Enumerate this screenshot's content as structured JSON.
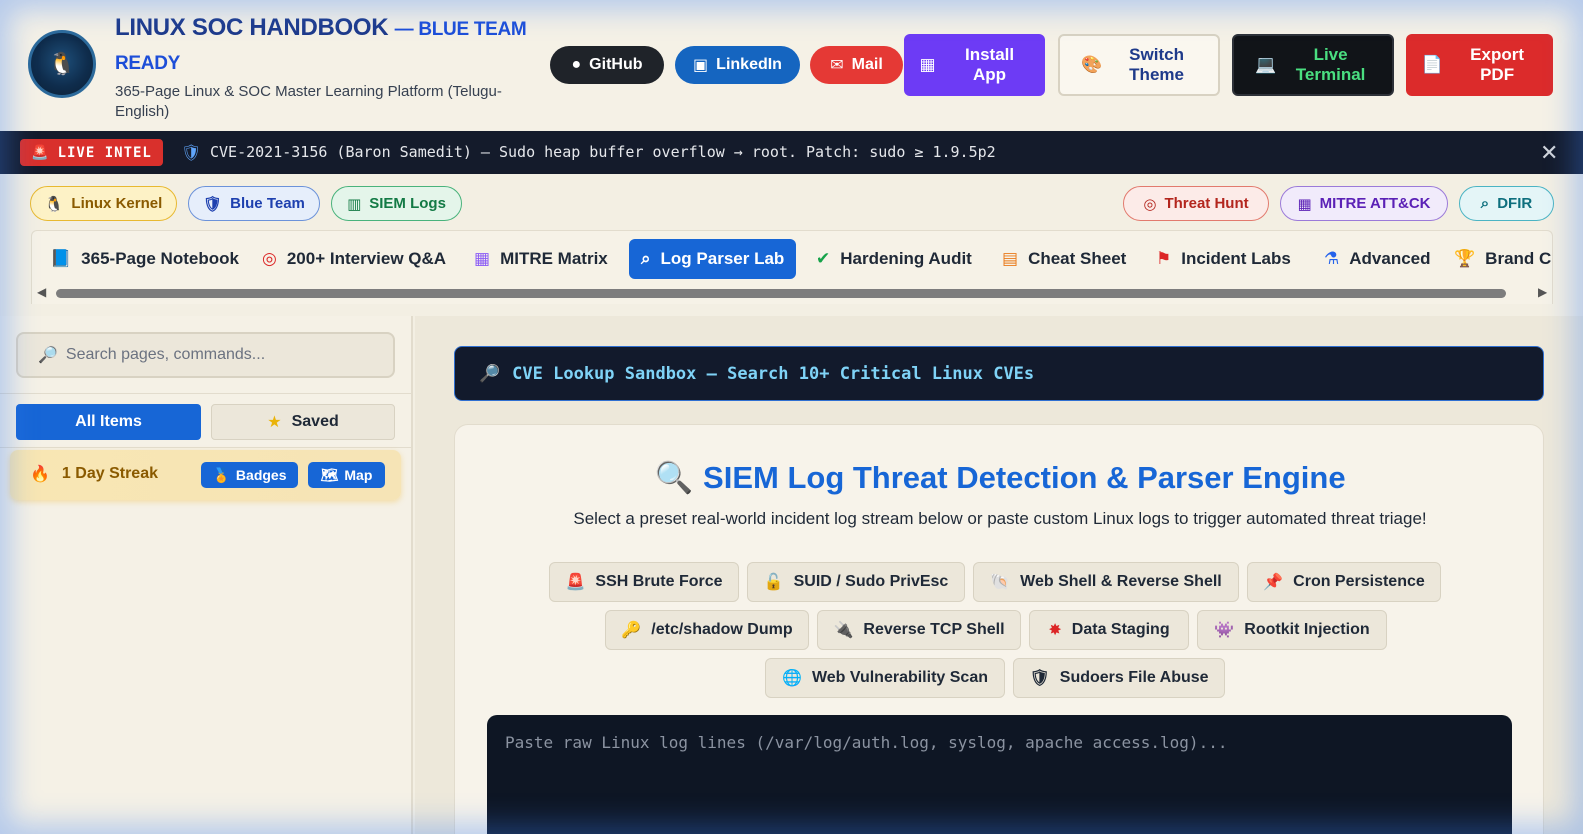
{
  "header": {
    "title": "LINUX SOC HANDBOOK",
    "title_accent": "— BLUE TEAM READY",
    "subtitle": "365-Page Linux & SOC Master Learning Platform (Telugu-English)",
    "buttons": {
      "github": "GitHub",
      "linkedin": "LinkedIn",
      "mail": "Mail",
      "install": "Install App",
      "theme": "Switch Theme",
      "terminal": "Live Terminal",
      "pdf": "Export PDF"
    }
  },
  "ticker": {
    "badge": "LIVE INTEL",
    "text": "CVE-2021-3156 (Baron Samedit) — Sudo heap buffer overflow → root. Patch: sudo ≥ 1.9.5p2"
  },
  "chips": {
    "left": [
      "Linux Kernel",
      "Blue Team",
      "SIEM Logs"
    ],
    "right": [
      "Threat Hunt",
      "MITRE ATT&CK",
      "DFIR"
    ]
  },
  "tabs": [
    {
      "label": "365-Page Notebook",
      "icon": "notebook-icon"
    },
    {
      "label": "200+ Interview Q&A",
      "icon": "target-icon"
    },
    {
      "label": "MITRE Matrix",
      "icon": "grid-icon"
    },
    {
      "label": "Log Parser Lab",
      "icon": "search-icon",
      "active": true
    },
    {
      "label": "Hardening Audit",
      "icon": "check-shield-icon"
    },
    {
      "label": "Cheat Sheet",
      "icon": "document-icon"
    },
    {
      "label": "Incident Labs",
      "icon": "flag-icon"
    },
    {
      "label": "Advanced",
      "icon": "flask-icon"
    },
    {
      "label": "Brand C",
      "icon": "trophy-icon"
    }
  ],
  "sidebar": {
    "search_placeholder": "Search pages, commands...",
    "all_items": "All Items",
    "saved": "Saved",
    "streak": "1 Day Streak",
    "badges": "Badges",
    "map": "Map"
  },
  "main": {
    "cve_bar": "CVE Lookup Sandbox — Search 10+ Critical Linux CVEs",
    "title": "SIEM Log Threat Detection & Parser Engine",
    "subtitle": "Select a preset real-world incident log stream below or paste custom Linux logs to trigger automated threat triage!",
    "presets": [
      "SSH Brute Force",
      "SUID / Sudo PrivEsc",
      "Web Shell & Reverse Shell",
      "Cron Persistence",
      "/etc/shadow Dump",
      "Reverse TCP Shell",
      "Data Staging",
      "Rootkit Injection",
      "Web Vulnerability Scan",
      "Sudoers File Abuse"
    ],
    "log_placeholder": "Paste raw Linux log lines (/var/log/auth.log, syslog, apache access.log)..."
  },
  "colors": {
    "accent": "#1766d6",
    "ticker_bg": "#141b2b",
    "live_badge": "#d9302c",
    "install": "#6d3bf5",
    "pdf": "#dc2b2b",
    "terminal_text": "#4ade80"
  }
}
